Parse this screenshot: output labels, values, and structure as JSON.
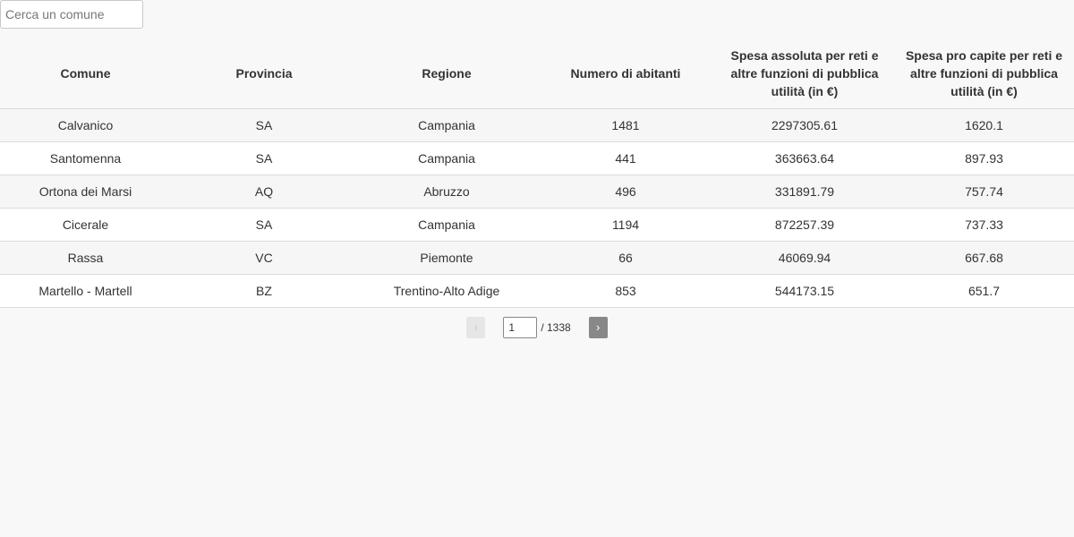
{
  "search": {
    "placeholder": "Cerca un comune",
    "value": ""
  },
  "table": {
    "headers": [
      "Comune",
      "Provincia",
      "Regione",
      "Numero di abitanti",
      "Spesa assoluta per reti e altre funzioni di pubblica utilità (in €)",
      "Spesa pro capite per reti e altre funzioni di pubblica utilità (in €)"
    ],
    "rows": [
      [
        "Calvanico",
        "SA",
        "Campania",
        "1481",
        "2297305.61",
        "1620.1"
      ],
      [
        "Santomenna",
        "SA",
        "Campania",
        "441",
        "363663.64",
        "897.93"
      ],
      [
        "Ortona dei Marsi",
        "AQ",
        "Abruzzo",
        "496",
        "331891.79",
        "757.74"
      ],
      [
        "Cicerale",
        "SA",
        "Campania",
        "1194",
        "872257.39",
        "737.33"
      ],
      [
        "Rassa",
        "VC",
        "Piemonte",
        "66",
        "46069.94",
        "667.68"
      ],
      [
        "Martello - Martell",
        "BZ",
        "Trentino-Alto Adige",
        "853",
        "544173.15",
        "651.7"
      ]
    ]
  },
  "pagination": {
    "prev_label": "‹",
    "next_label": "›",
    "current_page": "1",
    "total_label": "/ 1338"
  },
  "colors": {
    "background": "#f8f8f8",
    "next_button": "#888888",
    "prev_button_disabled": "#e6e6e6"
  }
}
